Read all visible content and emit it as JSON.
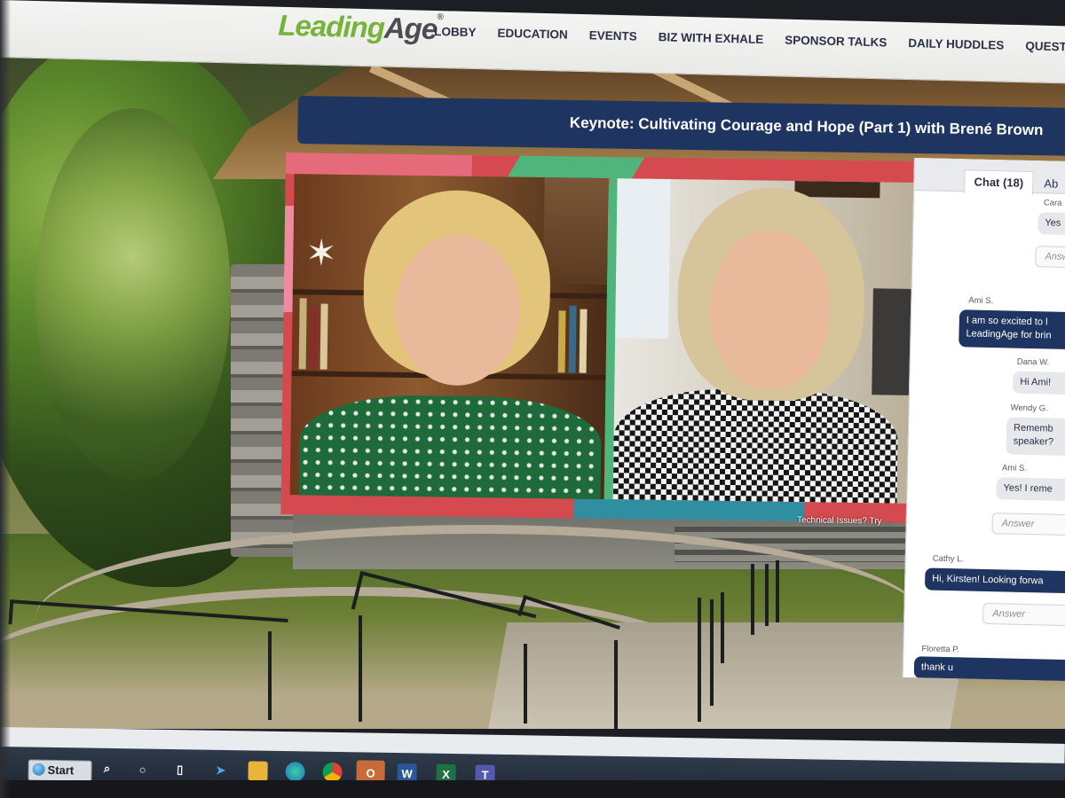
{
  "site": {
    "logo_part1": "Leading",
    "logo_part2": "Age",
    "logo_mark": "®",
    "nav": [
      "LOBBY",
      "EDUCATION",
      "EVENTS",
      "BIZ WITH EXHALE",
      "SPONSOR TALKS",
      "DAILY HUDDLES",
      "QUESTIONS"
    ]
  },
  "session": {
    "title": "Keynote: Cultivating Courage and Hope (Part 1) with Brené Brown"
  },
  "chat": {
    "tab_chat": "Chat (18)",
    "tab_about": "Ab",
    "answer_placeholder": "Answer",
    "messages": [
      {
        "author": "Cara",
        "text": "Yes",
        "mine": false,
        "has_answer": true
      },
      {
        "author": "Ami S.",
        "text_lines": [
          "I am so excited to l",
          "LeadingAge for brin"
        ],
        "mine": true,
        "has_answer": false
      },
      {
        "author": "Dana W.",
        "text": "Hi Ami!",
        "mine": false,
        "has_answer": false
      },
      {
        "author": "Wendy G.",
        "text_lines": [
          "Rememb",
          "speaker?"
        ],
        "mine": false,
        "has_answer": false
      },
      {
        "author": "Ami S.",
        "text": "Yes! I reme",
        "mine": false,
        "has_answer": true
      },
      {
        "author": "Cathy L.",
        "text": "Hi, Kirsten! Looking forwa",
        "mine": true,
        "has_answer": true
      },
      {
        "author": "Floretta P.",
        "text": "thank u",
        "mine": true,
        "has_answer": false
      }
    ]
  },
  "tech_issues": {
    "text": "Technical Issues? Try",
    "link": "..."
  },
  "taskbar": {
    "start_label": "Start",
    "icons": [
      "search-icon",
      "cortana-icon",
      "task-view-icon",
      "power-automate-icon",
      "file-explorer-icon",
      "edge-icon",
      "chrome-icon",
      "outlook-icon",
      "word-icon",
      "excel-icon",
      "teams-icon"
    ]
  },
  "colors": {
    "brand_green": "#77b23a",
    "navy": "#1f3561",
    "frame_red": "#d44a4e"
  }
}
